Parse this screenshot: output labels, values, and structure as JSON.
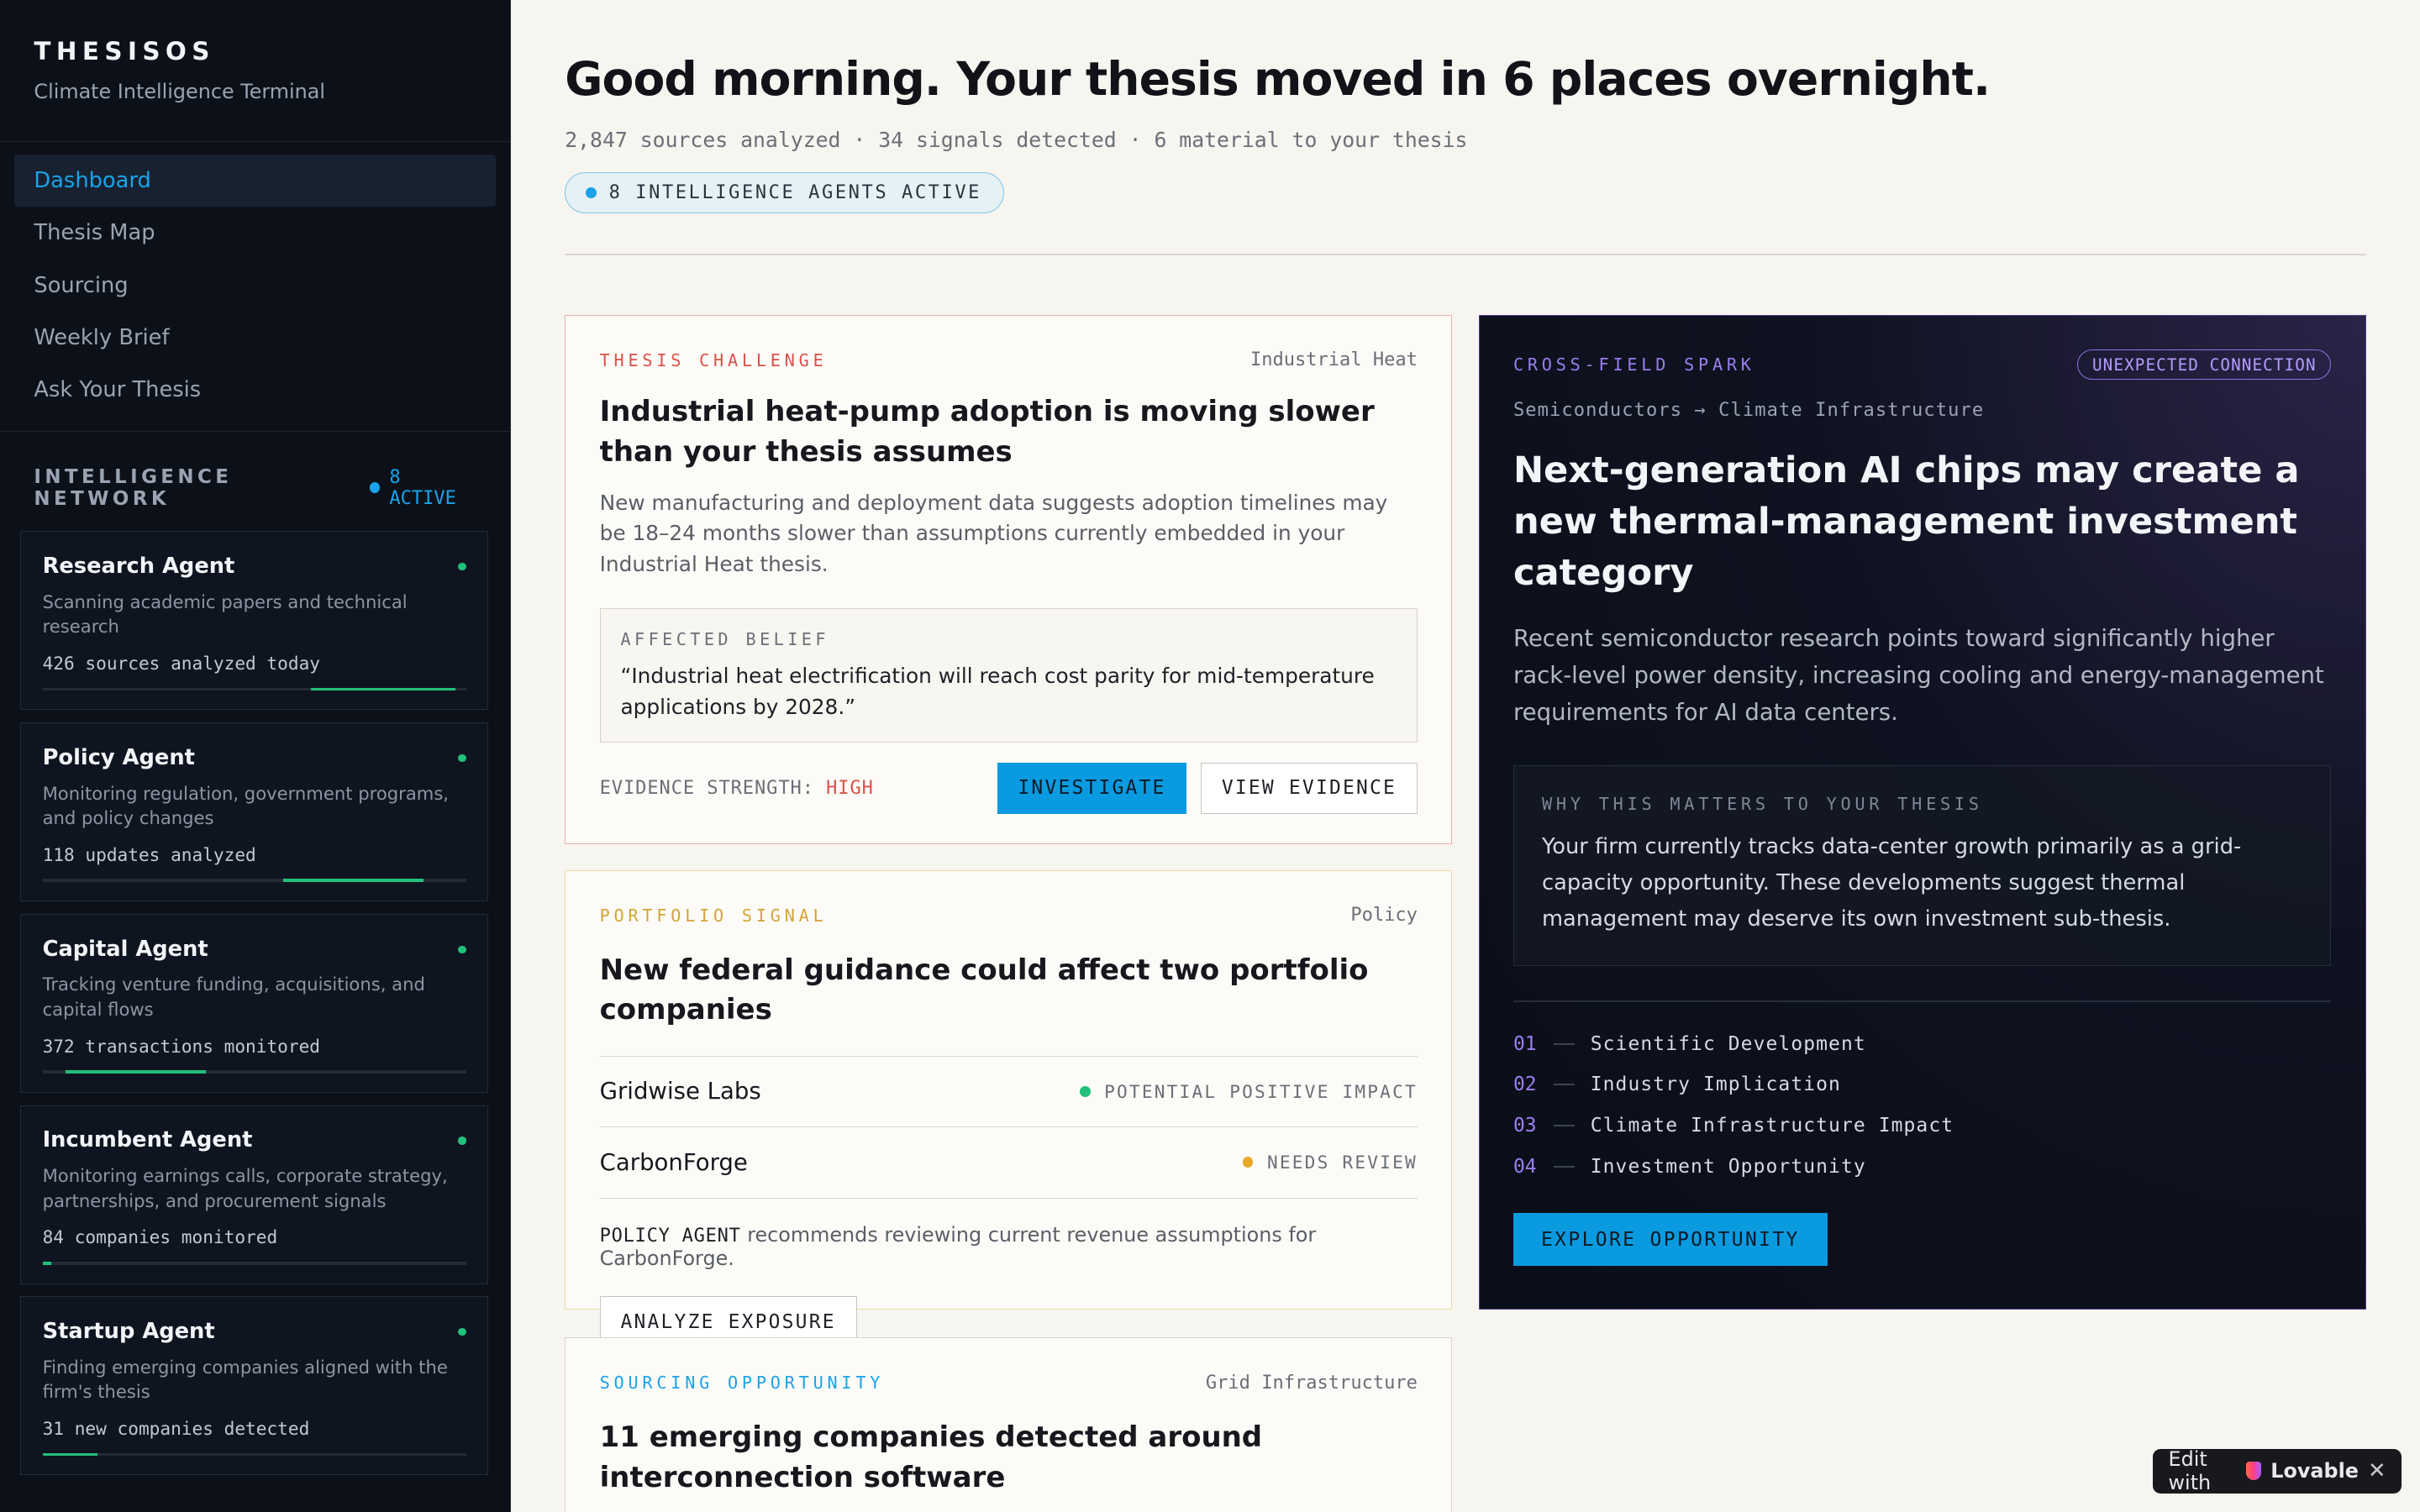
{
  "sidebar": {
    "brand": "THESISOS",
    "tagline": "Climate Intelligence Terminal",
    "nav": [
      "Dashboard",
      "Thesis Map",
      "Sourcing",
      "Weekly Brief",
      "Ask Your Thesis"
    ],
    "network_title": "INTELLIGENCE NETWORK",
    "network_count": "8 ACTIVE",
    "agents": [
      {
        "name": "Research Agent",
        "desc": "Scanning academic papers and technical research",
        "stat": "426 sources analyzed today",
        "progress": 0.34
      },
      {
        "name": "Policy Agent",
        "desc": "Monitoring regulation, government programs, and policy changes",
        "stat": "118 updates analyzed",
        "progress": 0.33
      },
      {
        "name": "Capital Agent",
        "desc": "Tracking venture funding, acquisitions, and capital flows",
        "stat": "372 transactions monitored",
        "progress": 0.33
      },
      {
        "name": "Incumbent Agent",
        "desc": "Monitoring earnings calls, corporate strategy, partnerships, and procurement signals",
        "stat": "84 companies monitored",
        "progress": 0.02
      },
      {
        "name": "Startup Agent",
        "desc": "Finding emerging companies aligned with the firm's thesis",
        "stat": "31 new companies detected",
        "progress": 0.13
      }
    ]
  },
  "header": {
    "title": "Good morning. Your thesis moved in 6 places overnight.",
    "subtitle": "2,847 sources analyzed · 34 signals detected · 6 material to your thesis",
    "pill": "8 INTELLIGENCE AGENTS ACTIVE"
  },
  "challenge": {
    "tag": "THESIS CHALLENGE",
    "topic": "Industrial Heat",
    "title": "Industrial heat-pump adoption is moving slower than your thesis assumes",
    "body": "New manufacturing and deployment data suggests adoption timelines may be 18–24 months slower than assumptions currently embedded in your Industrial Heat thesis.",
    "belief_label": "AFFECTED BELIEF",
    "belief": "“Industrial heat electrification will reach cost parity for mid-temperature applications by 2028.”",
    "evidence_label": "EVIDENCE STRENGTH:",
    "evidence_value": "HIGH",
    "investigate": "INVESTIGATE",
    "view_evidence": "VIEW EVIDENCE"
  },
  "portfolio": {
    "tag": "PORTFOLIO SIGNAL",
    "topic": "Policy",
    "title": "New federal guidance could affect two portfolio companies",
    "companies": [
      {
        "name": "Gridwise Labs",
        "status": "POTENTIAL POSITIVE IMPACT",
        "color": "#22c07a"
      },
      {
        "name": "CarbonForge",
        "status": "NEEDS REVIEW",
        "color": "#e8a92a"
      }
    ],
    "rec_agent": "POLICY AGENT",
    "rec_text": "recommends reviewing current revenue assumptions for CarbonForge.",
    "analyze": "ANALYZE EXPOSURE"
  },
  "sourcing": {
    "tag": "SOURCING OPPORTUNITY",
    "topic": "Grid Infrastructure",
    "title": "11 emerging companies detected around interconnection software"
  },
  "spark": {
    "tag": "CROSS-FIELD SPARK",
    "badge": "UNEXPECTED CONNECTION",
    "path": "Semiconductors → Climate Infrastructure",
    "title": "Next-generation AI chips may create a new thermal-management investment category",
    "body": "Recent semiconductor research points toward significantly higher rack-level power density, increasing cooling and energy-management requirements for AI data centers.",
    "why_label": "WHY THIS MATTERS TO YOUR THESIS",
    "why_text": "Your firm currently tracks data-center growth primarily as a grid-capacity opportunity. These developments suggest thermal management may deserve its own investment sub-thesis.",
    "steps": [
      {
        "num": "01",
        "label": "Scientific Development"
      },
      {
        "num": "02",
        "label": "Industry Implication"
      },
      {
        "num": "03",
        "label": "Climate Infrastructure Impact"
      },
      {
        "num": "04",
        "label": "Investment Opportunity"
      }
    ],
    "cta": "EXPLORE OPPORTUNITY"
  },
  "badge": {
    "prefix": "Edit with",
    "brand": "Lovable",
    "close": "✕"
  },
  "colors": {
    "accent": "#0a9ae0",
    "challenge": "#d9534a",
    "portfolio": "#d4a536",
    "sourcing": "#1aa3e8",
    "spark": "#9b7ff0",
    "positive": "#22c07a"
  }
}
